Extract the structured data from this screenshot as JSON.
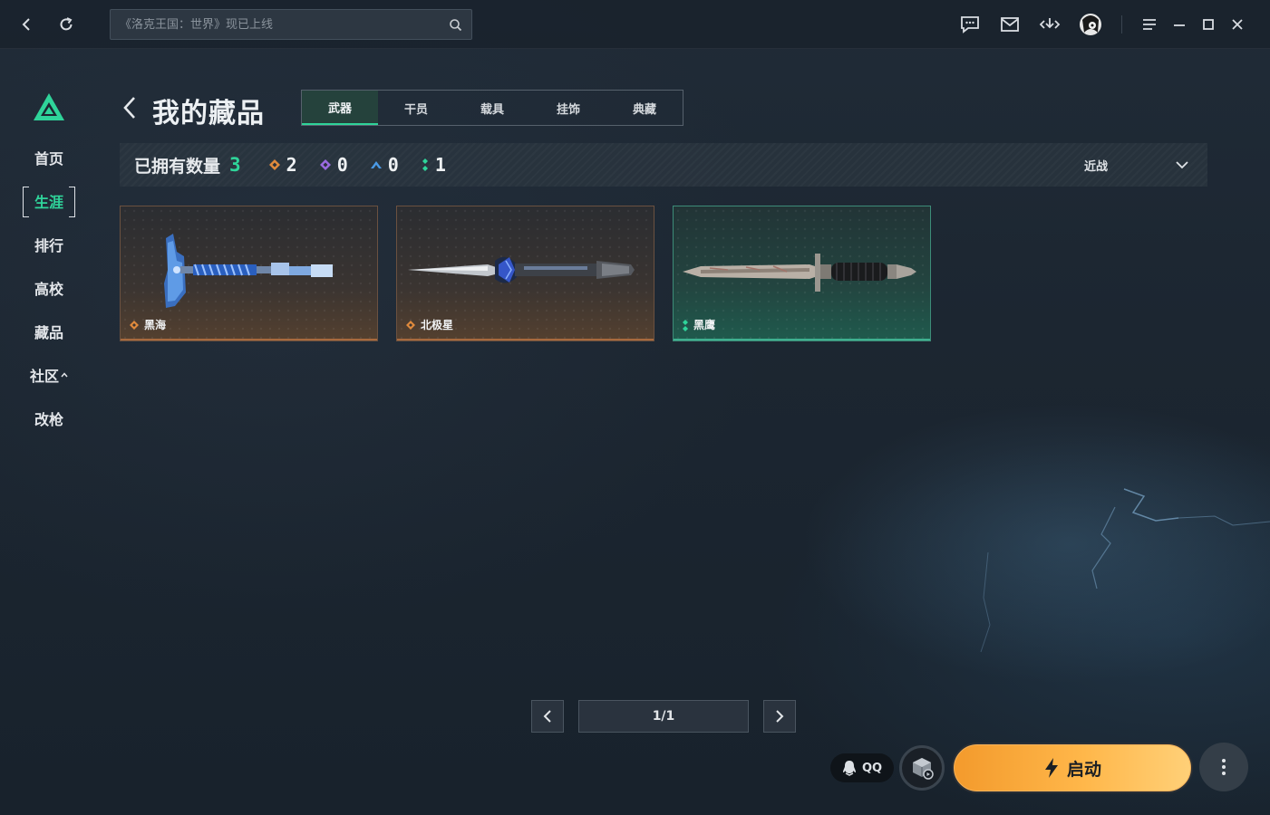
{
  "topbar": {
    "search_placeholder": "《洛克王国：世界》现已上线",
    "icons": [
      "back-icon",
      "refresh-icon",
      "search-icon",
      "chat-icon",
      "mail-icon",
      "download-icon",
      "avatar",
      "menu-icon",
      "minimize-icon",
      "maximize-icon",
      "close-icon"
    ]
  },
  "sidebar": {
    "items": [
      {
        "label": "首页"
      },
      {
        "label": "生涯",
        "active": true
      },
      {
        "label": "排行"
      },
      {
        "label": "高校"
      },
      {
        "label": "藏品"
      },
      {
        "label": "社区"
      },
      {
        "label": "改枪"
      }
    ],
    "community_caret": "^"
  },
  "header": {
    "title": "我的藏品",
    "tabs": [
      {
        "label": "武器",
        "active": true
      },
      {
        "label": "干员"
      },
      {
        "label": "载具"
      },
      {
        "label": "挂饰"
      },
      {
        "label": "典藏"
      }
    ]
  },
  "counts": {
    "label": "已拥有数量",
    "total": "3",
    "rarities": [
      {
        "icon": "orange-diamond-icon",
        "color": "#e08a3c",
        "count": "2"
      },
      {
        "icon": "purple-diamond-icon",
        "color": "#9a6ae0",
        "count": "0"
      },
      {
        "icon": "blue-arrow-icon",
        "color": "#4a9ae6",
        "count": "0"
      },
      {
        "icon": "green-dots-icon",
        "color": "#2fd49a",
        "count": "1"
      }
    ],
    "filter_label": "近战"
  },
  "items": [
    {
      "name": "黑海",
      "rarity": "orange",
      "weapon_icon": "axe-icon"
    },
    {
      "name": "北极星",
      "rarity": "orange",
      "weapon_icon": "dagger-icon"
    },
    {
      "name": "黑鹰",
      "rarity": "green",
      "weapon_icon": "knife-icon"
    }
  ],
  "pagination": {
    "page": "1/1"
  },
  "bottom": {
    "qq_label": "QQ",
    "launch_label": "启动"
  },
  "colors": {
    "accent_green": "#2fd49a",
    "launch_orange": "#f39a2c",
    "rarity_orange": "#e08a3c"
  }
}
